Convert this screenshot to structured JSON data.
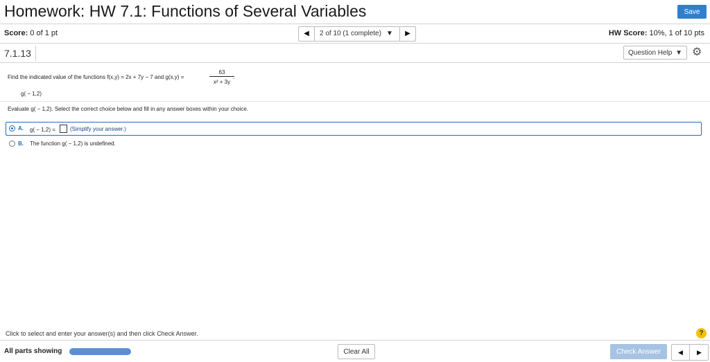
{
  "header": {
    "title": "Homework: HW 7.1: Functions of Several Variables",
    "save_label": "Save"
  },
  "score_bar": {
    "score_label": "Score:",
    "score_value": " 0 of 1 pt",
    "question_nav": "2 of 10 (1 complete)",
    "hw_score_label": "HW Score:",
    "hw_score_value": " 10%, 1 of 10 pts"
  },
  "question": {
    "number": "7.1.13",
    "help_label": "Question Help",
    "prompt": "Find the indicated value of the functions f(x,y) = 2x + 7y − 7 and g(x,y) =",
    "fraction_numerator": "63",
    "fraction_denominator": "x² + 3y",
    "fraction_tail": ".",
    "point": "g( − 1,2)",
    "instruction": "Evaluate g( − 1,2). Select the correct choice below and fill in any answer boxes within your choice."
  },
  "choices": [
    {
      "letter": "A.",
      "text": "g( − 1,2) =",
      "hint": "(Simplify your answer.)",
      "selected": true
    },
    {
      "letter": "B.",
      "text": "The function g( − 1,2) is undefined.",
      "selected": false
    }
  ],
  "footer": {
    "help_text": "Click to select and enter your answer(s) and then click Check Answer.",
    "help_icon": "?",
    "all_parts_label": "All parts showing",
    "clear_all_label": "Clear All",
    "check_answer_label": "Check Answer"
  },
  "colors": {
    "accent": "#2f7fd0",
    "selected_border": "#1f6bb5",
    "progress": "#5b8fd4",
    "check_disabled": "#a7c3e3",
    "help_badge": "#f2c200"
  },
  "icons": [
    "left-arrow-icon",
    "right-arrow-icon",
    "dropdown-arrow-icon",
    "gear-icon",
    "question-mark-icon"
  ]
}
